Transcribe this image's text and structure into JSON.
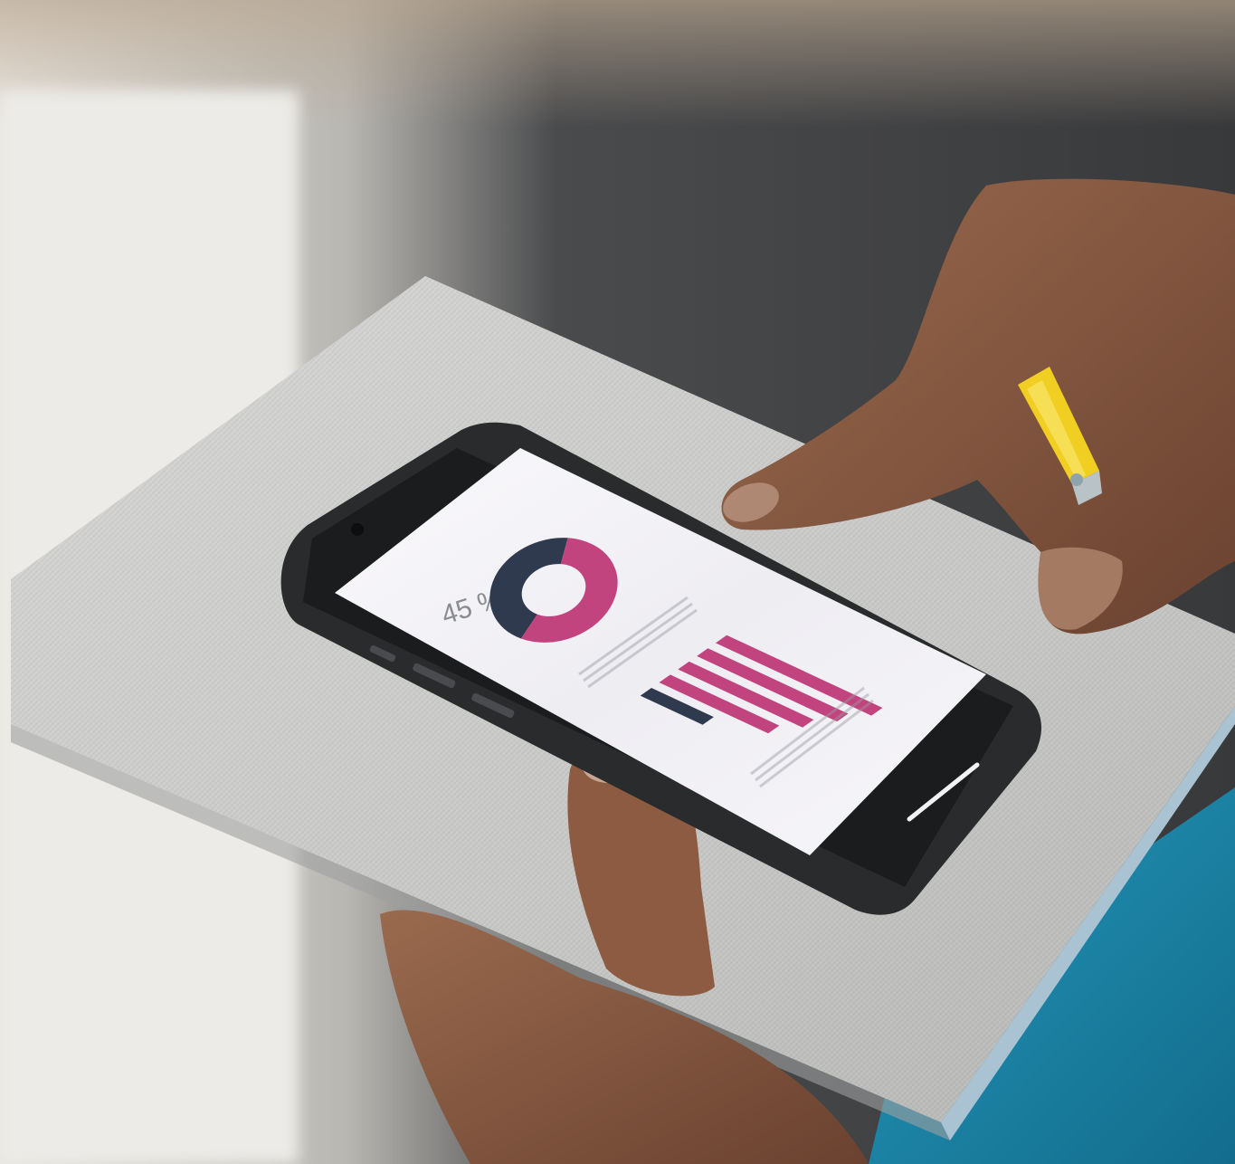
{
  "photo": {
    "scene": "hands-holding-smartphone-over-notebook",
    "colors": {
      "background_dark": "#3c3d3f",
      "background_light": "#e8e6e1",
      "notebook": "#cfcfcd",
      "phone_frame": "#2a2b2d",
      "screen": "#f2f1f6",
      "accent_magenta": "#c2447f",
      "accent_navy": "#2f3a4f",
      "pencil": "#f0cf22",
      "skin": "#8a5a3f",
      "teal_object": "#1d86a8"
    }
  },
  "phone_screen": {
    "percent_label": "45 %",
    "chart_data": [
      {
        "type": "pie",
        "title": "",
        "values": [
          45,
          55
        ],
        "colors": [
          "#2f3a4f",
          "#c2447f"
        ]
      },
      {
        "type": "bar",
        "title": "",
        "categories": [
          "",
          "",
          "",
          "",
          ""
        ],
        "values": [
          4,
          7,
          8,
          9,
          10
        ],
        "colors": [
          "#2f3a4f",
          "#c2447f",
          "#c2447f",
          "#c2447f",
          "#c2447f"
        ]
      }
    ]
  }
}
